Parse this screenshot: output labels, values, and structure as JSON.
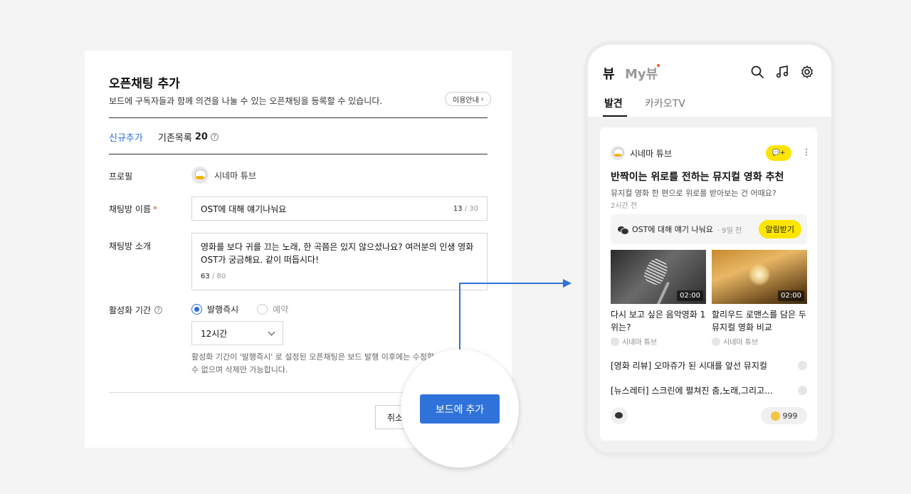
{
  "form": {
    "title": "오픈채팅 추가",
    "description": "보드에 구독자들과 함께 의견을 나눌 수 있는 오픈채팅을 등록할 수 있습니다.",
    "guide_label": "이용안내",
    "tab_new": "신규추가",
    "tab_existing_label": "기존목록",
    "tab_existing_count": "20",
    "profile_label": "프로필",
    "profile_name": "시네마 튜브",
    "room_name_label": "채팅방 이름",
    "room_name_required": "*",
    "room_name_value": "OST에 대해 얘기나눠요",
    "room_name_count": "13",
    "room_name_max": " / 30",
    "intro_label": "채팅방 소개",
    "intro_value": "영화를 보다 귀를 끄는 노래, 한 곡쯤은 있지 않으셨나요? 여러분의 인생 영화 OST가 궁금해요. 같이 떠듭시다!",
    "intro_count": "63",
    "intro_max": " / 80",
    "period_label": "활성화 기간",
    "radio_immediate": "발행즉시",
    "radio_reserve": "예약",
    "select_value": "12시간",
    "note": "활성화 기간이 '발행즉시' 로 설정된 오픈채팅은 보드 발행 이후에는 수정할 수 없으며 삭제만 가능합니다.",
    "cancel_label": "취소",
    "submit_label": "보드에 추가"
  },
  "phone": {
    "logo": "뷰",
    "logo2": "My뷰",
    "tab_discover": "발견",
    "tab_kakaotv": "카카오TV",
    "card": {
      "channel": "시네마 튜브",
      "chat_badge": "💬+",
      "title": "반짝이는 위로를 전하는 뮤지컬 영화 추천",
      "subtitle": "뮤지컬 영화 한 편으로 위로를 받아보는 건 어때요?",
      "time": "2시간 전",
      "chat_title": "OST에 대해 얘기 나눠요",
      "chat_ago": "· 9일 전",
      "alarm_label": "알림받기",
      "videos": [
        {
          "duration": "02:00",
          "title": "다시 보고 싶은 음악영화 1위는?",
          "source": "시네마 튜브"
        },
        {
          "duration": "02:00",
          "title": "할리우드 로맨스를 담은 두 뮤지컬 영화 비교",
          "source": "시네마 튜브"
        }
      ],
      "list": [
        "[영화 리뷰] 오마쥬가 된 시대를 앞선 뮤지컬",
        "[뉴스레터] 스크린에 펼쳐진 춤,노래,그리고…"
      ],
      "like_count": "999"
    }
  },
  "colors": {
    "accent": "#2f72da",
    "kakao_yellow": "#fee500",
    "required": "#e0533a"
  }
}
